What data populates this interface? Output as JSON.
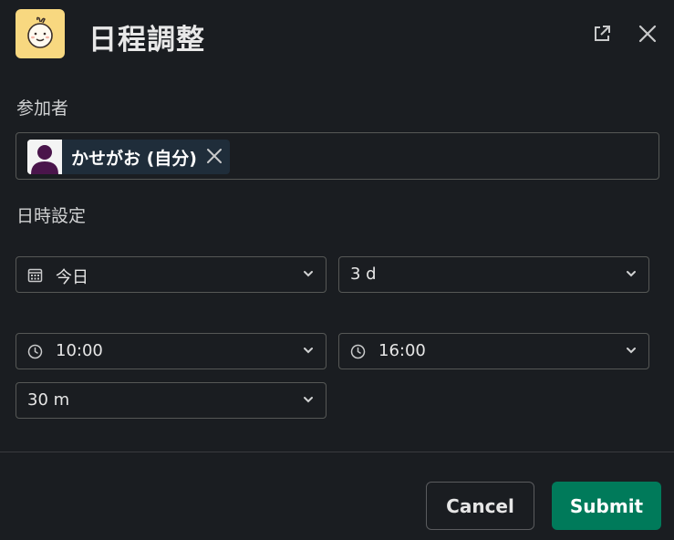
{
  "modal": {
    "title": "日程調整",
    "app_icon": "smiling-face-icon",
    "accent_color": "#f8d880"
  },
  "participants": {
    "label": "参加者",
    "selected": [
      {
        "name": "かせがお (自分)",
        "avatar": "person-avatar"
      }
    ]
  },
  "datetime": {
    "label": "日時設定",
    "date_select": {
      "value": "今日",
      "icon": "calendar-icon"
    },
    "duration_days_select": {
      "value": "3 d"
    },
    "start_time_select": {
      "value": "10:00",
      "icon": "clock-icon"
    },
    "end_time_select": {
      "value": "16:00",
      "icon": "clock-icon"
    },
    "slot_length_select": {
      "value": "30 m"
    }
  },
  "footer": {
    "cancel_label": "Cancel",
    "submit_label": "Submit",
    "submit_color": "#007a5a"
  }
}
